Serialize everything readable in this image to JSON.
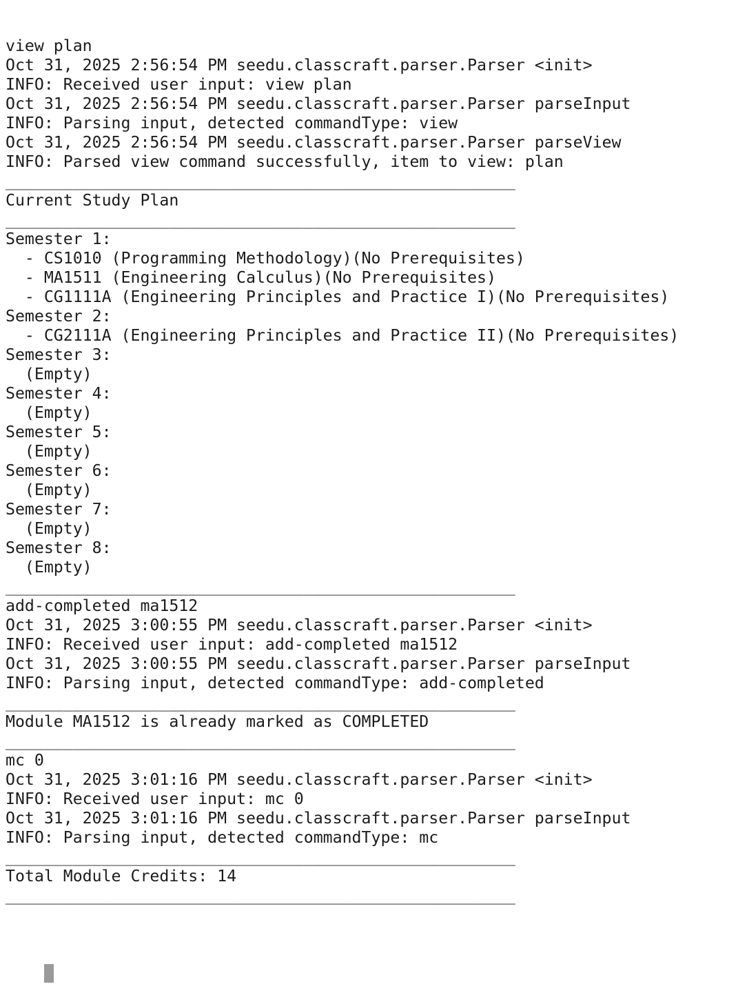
{
  "terminal": {
    "lines": [
      {
        "text": "view plan",
        "kind": "command"
      },
      {
        "text": "Oct 31, 2025 2:56:54 PM seedu.classcraft.parser.Parser <init>",
        "kind": "log"
      },
      {
        "text": "INFO: Received user input: view plan",
        "kind": "log"
      },
      {
        "text": "Oct 31, 2025 2:56:54 PM seedu.classcraft.parser.Parser parseInput",
        "kind": "log"
      },
      {
        "text": "INFO: Parsing input, detected commandType: view",
        "kind": "log"
      },
      {
        "text": "Oct 31, 2025 2:56:54 PM seedu.classcraft.parser.Parser parseView",
        "kind": "log"
      },
      {
        "text": "INFO: Parsed view command successfully, item to view: plan",
        "kind": "log"
      },
      {
        "text": "_____________________________________________________",
        "kind": "divider"
      },
      {
        "text": "Current Study Plan",
        "kind": "output"
      },
      {
        "text": "_____________________________________________________",
        "kind": "divider"
      },
      {
        "text": "Semester 1:",
        "kind": "output"
      },
      {
        "text": "  - CS1010 (Programming Methodology)(No Prerequisites)",
        "kind": "output"
      },
      {
        "text": "  - MA1511 (Engineering Calculus)(No Prerequisites)",
        "kind": "output"
      },
      {
        "text": "  - CG1111A (Engineering Principles and Practice I)(No Prerequisites)",
        "kind": "output"
      },
      {
        "text": "Semester 2:",
        "kind": "output"
      },
      {
        "text": "  - CG2111A (Engineering Principles and Practice II)(No Prerequisites)",
        "kind": "output"
      },
      {
        "text": "Semester 3:",
        "kind": "output"
      },
      {
        "text": "  (Empty)",
        "kind": "output"
      },
      {
        "text": "Semester 4:",
        "kind": "output"
      },
      {
        "text": "  (Empty)",
        "kind": "output"
      },
      {
        "text": "Semester 5:",
        "kind": "output"
      },
      {
        "text": "  (Empty)",
        "kind": "output"
      },
      {
        "text": "Semester 6:",
        "kind": "output"
      },
      {
        "text": "  (Empty)",
        "kind": "output"
      },
      {
        "text": "Semester 7:",
        "kind": "output"
      },
      {
        "text": "  (Empty)",
        "kind": "output"
      },
      {
        "text": "Semester 8:",
        "kind": "output"
      },
      {
        "text": "  (Empty)",
        "kind": "output"
      },
      {
        "text": "_____________________________________________________",
        "kind": "divider"
      },
      {
        "text": "add-completed ma1512",
        "kind": "command"
      },
      {
        "text": "Oct 31, 2025 3:00:55 PM seedu.classcraft.parser.Parser <init>",
        "kind": "log"
      },
      {
        "text": "INFO: Received user input: add-completed ma1512",
        "kind": "log"
      },
      {
        "text": "Oct 31, 2025 3:00:55 PM seedu.classcraft.parser.Parser parseInput",
        "kind": "log"
      },
      {
        "text": "INFO: Parsing input, detected commandType: add-completed",
        "kind": "log"
      },
      {
        "text": "_____________________________________________________",
        "kind": "divider"
      },
      {
        "text": "Module MA1512 is already marked as COMPLETED",
        "kind": "output"
      },
      {
        "text": "_____________________________________________________",
        "kind": "divider"
      },
      {
        "text": "mc 0",
        "kind": "command"
      },
      {
        "text": "Oct 31, 2025 3:01:16 PM seedu.classcraft.parser.Parser <init>",
        "kind": "log"
      },
      {
        "text": "INFO: Received user input: mc 0",
        "kind": "log"
      },
      {
        "text": "Oct 31, 2025 3:01:16 PM seedu.classcraft.parser.Parser parseInput",
        "kind": "log"
      },
      {
        "text": "INFO: Parsing input, detected commandType: mc",
        "kind": "log"
      },
      {
        "text": "_____________________________________________________",
        "kind": "divider"
      },
      {
        "text": "Total Module Credits: 14",
        "kind": "output"
      },
      {
        "text": "_____________________________________________________",
        "kind": "divider"
      }
    ],
    "input_value": ""
  }
}
